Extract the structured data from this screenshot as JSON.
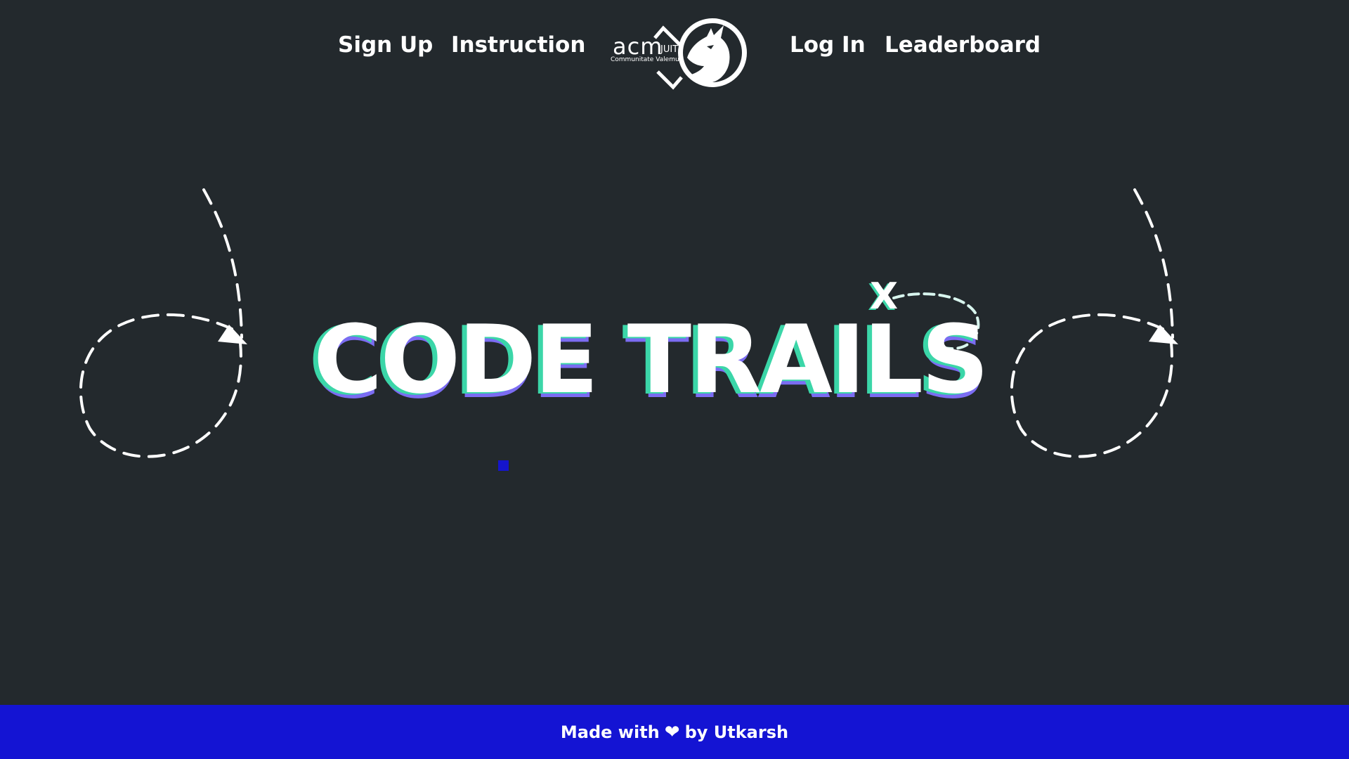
{
  "nav": {
    "left": [
      {
        "label": "Sign Up"
      },
      {
        "label": "Instruction"
      }
    ],
    "right": [
      {
        "label": "Log In"
      },
      {
        "label": "Leaderboard"
      }
    ],
    "logo": {
      "text": "acm",
      "sup": "JUIT",
      "tagline": "Communitate Valemus"
    }
  },
  "hero": {
    "title": "CODE TRAILS",
    "mark": "X"
  },
  "footer": {
    "prefix": "Made with",
    "icon": "heart-icon",
    "suffix": "by Utkarsh"
  },
  "colors": {
    "background": "#23292d",
    "accent_blue": "#1414d3",
    "shadow_purple": "#7b6cf2",
    "shadow_green": "#3bd6a8",
    "text": "#ffffff"
  }
}
